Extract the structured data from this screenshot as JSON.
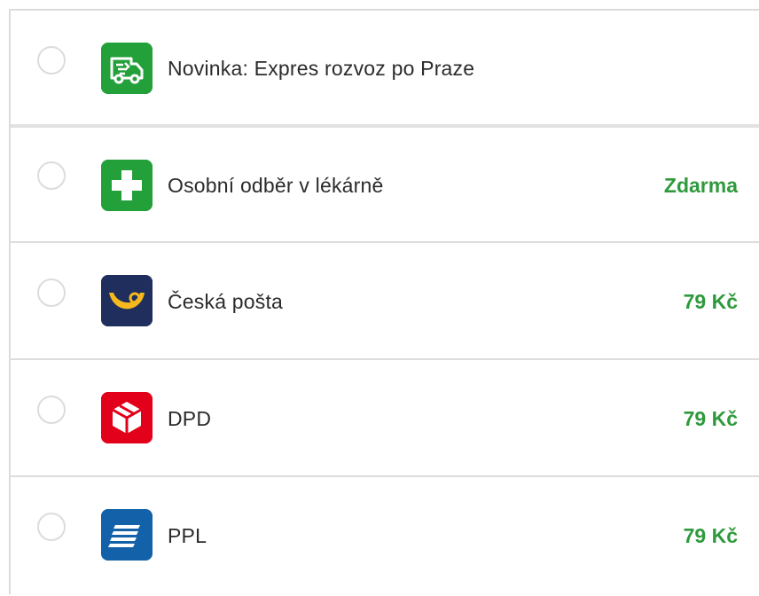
{
  "shipping_options": [
    {
      "label": "Novinka: Expres rozvoz po Praze",
      "price": "",
      "icon": "delivery-van-icon",
      "icon_bg": "#23a03a"
    },
    {
      "label": "Osobní odběr v lékárně",
      "price": "Zdarma",
      "icon": "pharmacy-cross-icon",
      "icon_bg": "#23a03a"
    },
    {
      "label": "Česká pošta",
      "price": "79 Kč",
      "icon": "post-horn-icon",
      "icon_bg": "#1f2e5c"
    },
    {
      "label": "DPD",
      "price": "79 Kč",
      "icon": "dpd-cube-icon",
      "icon_bg": "#e3001b"
    },
    {
      "label": "PPL",
      "price": "79 Kč",
      "icon": "ppl-stripes-icon",
      "icon_bg": "#1361a8"
    }
  ],
  "colors": {
    "price_green": "#2e9a3c",
    "divider": "#dddddd",
    "radio_border": "#dcdcdc"
  }
}
